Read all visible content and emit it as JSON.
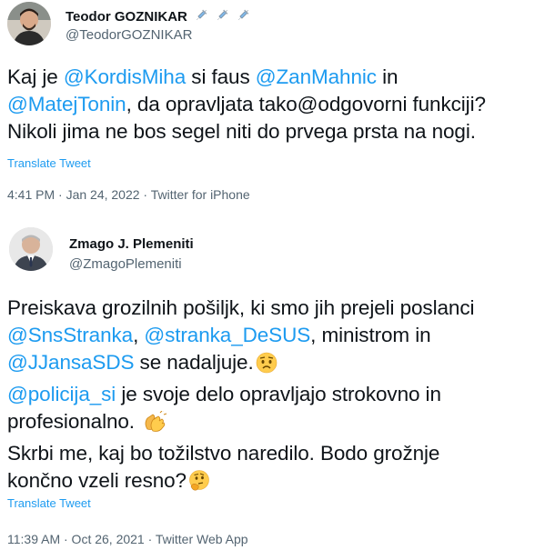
{
  "tweets": [
    {
      "author_name": "Teodor GOZNIKAR",
      "handle": "@TeodorGOZNIKAR",
      "name_icons": [
        "syringe-icon",
        "syringe-icon",
        "syringe-icon"
      ],
      "lines": [
        [
          {
            "t": "Kaj je "
          },
          {
            "t": "@KordisMiha",
            "m": true
          },
          {
            "t": " si faus "
          },
          {
            "t": "@ZanMahnic",
            "m": true
          },
          {
            "t": " in"
          }
        ],
        [
          {
            "t": "@MatejTonin",
            "m": true
          },
          {
            "t": ", da opravljata tako@odgovorni funkciji?"
          }
        ],
        [
          {
            "t": "Nikoli jima ne bos segel niti do prvega prsta na nogi."
          }
        ]
      ],
      "translate_label": "Translate Tweet",
      "meta": "4:41 PM · Jan 24, 2022 · Twitter for iPhone"
    },
    {
      "author_name": "Zmago J. Plemeniti",
      "handle": "@ZmagoPlemeniti",
      "lines": [
        [
          {
            "t": "Preiskava grozilnih pošiljk, ki smo jih prejeli poslanci"
          }
        ],
        [
          {
            "t": "@SnsStranka",
            "m": true
          },
          {
            "t": ", "
          },
          {
            "t": "@stranka_DeSUS",
            "m": true
          },
          {
            "t": ", ministrom in"
          }
        ],
        [
          {
            "t": "@JJansaSDS",
            "m": true
          },
          {
            "t": " se nadaljuje."
          },
          {
            "e": "worried-face-emoji"
          }
        ],
        [
          {
            "t": " "
          },
          {
            "t": "@policija_si",
            "m": true
          },
          {
            "t": " je svoje delo opravljajo strokovno in"
          }
        ],
        [
          {
            "t": "profesionalno. "
          },
          {
            "e": "clapping-hands-emoji"
          }
        ],
        [
          {
            "t": "Skrbi me, kaj bo tožilstvo naredilo. Bodo grožnje"
          }
        ],
        [
          {
            "t": "končno vzeli resno?"
          },
          {
            "e": "thinking-face-emoji"
          }
        ]
      ],
      "translate_label": "Translate Tweet",
      "meta": "11:39 AM · Oct 26, 2021 · Twitter Web App"
    }
  ],
  "colors": {
    "mention": "#1d9bf0",
    "text": "#0f1419",
    "secondary": "#536471"
  }
}
